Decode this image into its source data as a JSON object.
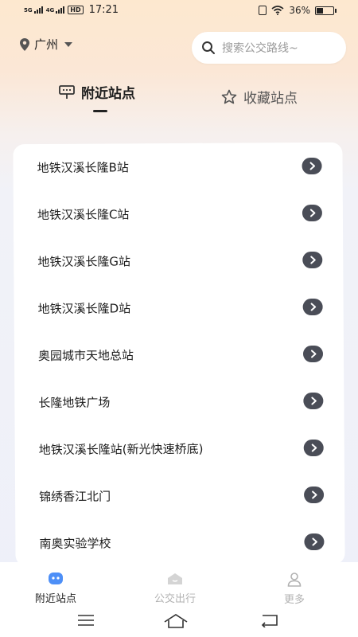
{
  "status_bar": {
    "network_1": "5G",
    "network_2": "4G",
    "hd_badge": "HD",
    "time": "17:21",
    "battery_percent": "36%",
    "battery_level": 0.36
  },
  "header": {
    "city": "广州",
    "search_placeholder": "搜索公交路线~"
  },
  "top_tabs": [
    {
      "label": "附近站点",
      "active": true,
      "icon": "bus-stop-sign-icon"
    },
    {
      "label": "收藏站点",
      "active": false,
      "icon": "star-icon"
    }
  ],
  "stops": [
    {
      "name": "地铁汉溪长隆B站"
    },
    {
      "name": "地铁汉溪长隆C站"
    },
    {
      "name": "地铁汉溪长隆G站"
    },
    {
      "name": "地铁汉溪长隆D站"
    },
    {
      "name": "奥园城市天地总站"
    },
    {
      "name": "长隆地铁广场"
    },
    {
      "name": "地铁汉溪长隆站(新光快速桥底)"
    },
    {
      "name": "锦绣香江北门"
    },
    {
      "name": "南奥实验学校"
    }
  ],
  "bottom_nav": [
    {
      "label": "附近站点",
      "active": true,
      "icon": "nearby-stops-icon"
    },
    {
      "label": "公交出行",
      "active": false,
      "icon": "bus-travel-icon"
    },
    {
      "label": "更多",
      "active": false,
      "icon": "person-icon"
    }
  ],
  "colors": {
    "accent": "#4d8ff7",
    "arrow_button": "#4a4d57",
    "inactive": "#b2b2b2"
  }
}
